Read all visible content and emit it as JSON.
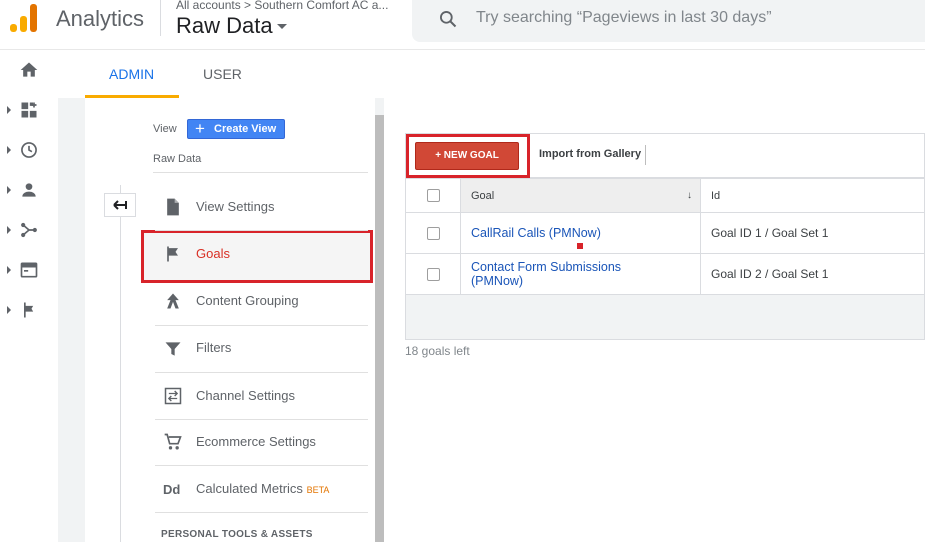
{
  "colors": {
    "accent": "#1a73e8",
    "brand": "#f9ab00",
    "new_goal": "#d14836",
    "highlight": "#d8232a"
  },
  "header": {
    "app_name": "Analytics",
    "breadcrumb": "All accounts > Southern Comfort AC a...",
    "view_name": "Raw Data",
    "search_placeholder": "Try searching “Pageviews in last 30 days”"
  },
  "leftnav": {
    "icons": [
      "home-icon",
      "dashboard-icon",
      "clock-icon",
      "person-icon",
      "acquisition-icon",
      "behavior-icon",
      "flag-icon"
    ]
  },
  "tabs": [
    {
      "label": "ADMIN",
      "active": true
    },
    {
      "label": "USER",
      "active": false
    }
  ],
  "view_column": {
    "view_label": "View",
    "create_view_label": "Create View",
    "view_selected": "Raw Data",
    "menu": [
      {
        "label": "View Settings",
        "icon": "document-icon"
      },
      {
        "label": "Goals",
        "icon": "flag-icon",
        "active": true
      },
      {
        "label": "Content Grouping",
        "icon": "content-grouping-icon"
      },
      {
        "label": "Filters",
        "icon": "filter-icon"
      },
      {
        "label": "Channel Settings",
        "icon": "channel-icon"
      },
      {
        "label": "Ecommerce Settings",
        "icon": "cart-icon"
      },
      {
        "label": "Calculated Metrics",
        "icon": "dd-icon",
        "badge": "BETA"
      }
    ],
    "section_header": "PERSONAL TOOLS & ASSETS"
  },
  "goals_panel": {
    "new_goal_label": "+ NEW GOAL",
    "import_label": "Import from Gallery",
    "columns": [
      "Goal",
      "Id"
    ],
    "rows": [
      {
        "goal_line1": "CallRail Calls (PMNow)",
        "goal_line2": "",
        "id": "Goal ID 1 / Goal Set 1"
      },
      {
        "goal_line1": "Contact Form Submissions",
        "goal_line2": "(PMNow)",
        "id": "Goal ID 2 / Goal Set 1"
      }
    ],
    "goals_left": "18 goals left"
  }
}
